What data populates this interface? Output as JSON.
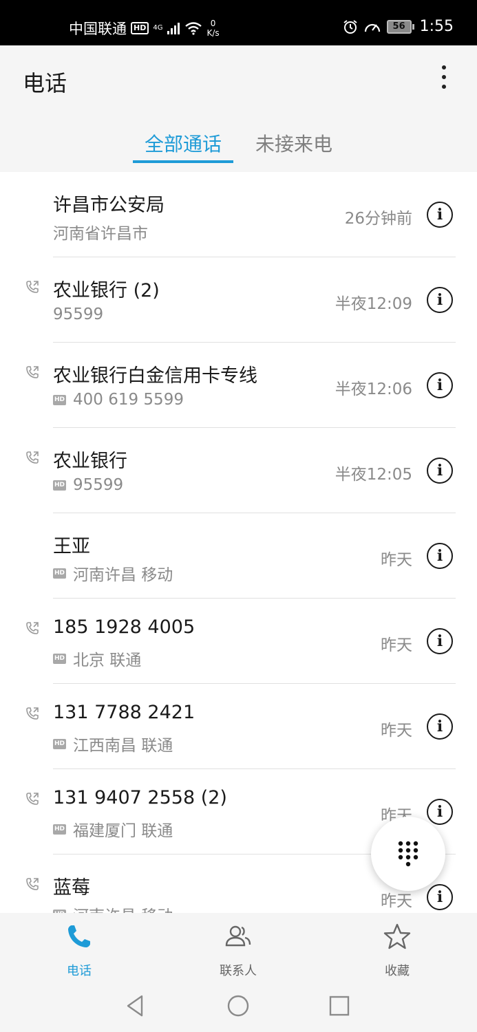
{
  "status_bar": {
    "carrier": "中国联通",
    "hd": "HD",
    "network": "4G",
    "speed_value": "0",
    "speed_unit": "K/s",
    "battery": "56",
    "time": "1:55"
  },
  "header": {
    "title": "电话"
  },
  "tabs": [
    {
      "label": "全部通话",
      "active": true
    },
    {
      "label": "未接来电",
      "active": false
    }
  ],
  "calls": [
    {
      "name": "许昌市公安局",
      "sub": "河南省许昌市",
      "time": "26分钟前",
      "hd": false,
      "call_icon": false
    },
    {
      "name": "农业银行 (2)",
      "sub": "95599",
      "time": "半夜12:09",
      "hd": false,
      "call_icon": true
    },
    {
      "name": "农业银行白金信用卡专线",
      "sub": "400 619 5599",
      "time": "半夜12:06",
      "hd": true,
      "call_icon": true
    },
    {
      "name": "农业银行",
      "sub": "95599",
      "time": "半夜12:05",
      "hd": true,
      "call_icon": true
    },
    {
      "name": "王亚",
      "sub": "河南许昌 移动",
      "time": "昨天",
      "hd": true,
      "call_icon": false
    },
    {
      "name": "185 1928 4005",
      "sub": "北京 联通",
      "time": "昨天",
      "hd": true,
      "call_icon": true
    },
    {
      "name": "131 7788 2421",
      "sub": "江西南昌 联通",
      "time": "昨天",
      "hd": true,
      "call_icon": true
    },
    {
      "name": "131 9407 2558 (2)",
      "sub": "福建厦门 联通",
      "time": "昨天",
      "hd": true,
      "call_icon": true
    },
    {
      "name": "蓝莓",
      "sub": "河南许昌 移动",
      "time": "昨天",
      "hd": true,
      "call_icon": true
    }
  ],
  "hd_badge": "HD",
  "info_glyph": "i",
  "bottom_nav": [
    {
      "label": "电话",
      "icon": "phone-icon",
      "active": true
    },
    {
      "label": "联系人",
      "icon": "contacts-icon",
      "active": false
    },
    {
      "label": "收藏",
      "icon": "star-icon",
      "active": false
    }
  ],
  "colors": {
    "accent": "#1e9bd7",
    "text_primary": "#1a1a1a",
    "text_secondary": "#8a8a8a",
    "background": "#f5f5f5"
  }
}
